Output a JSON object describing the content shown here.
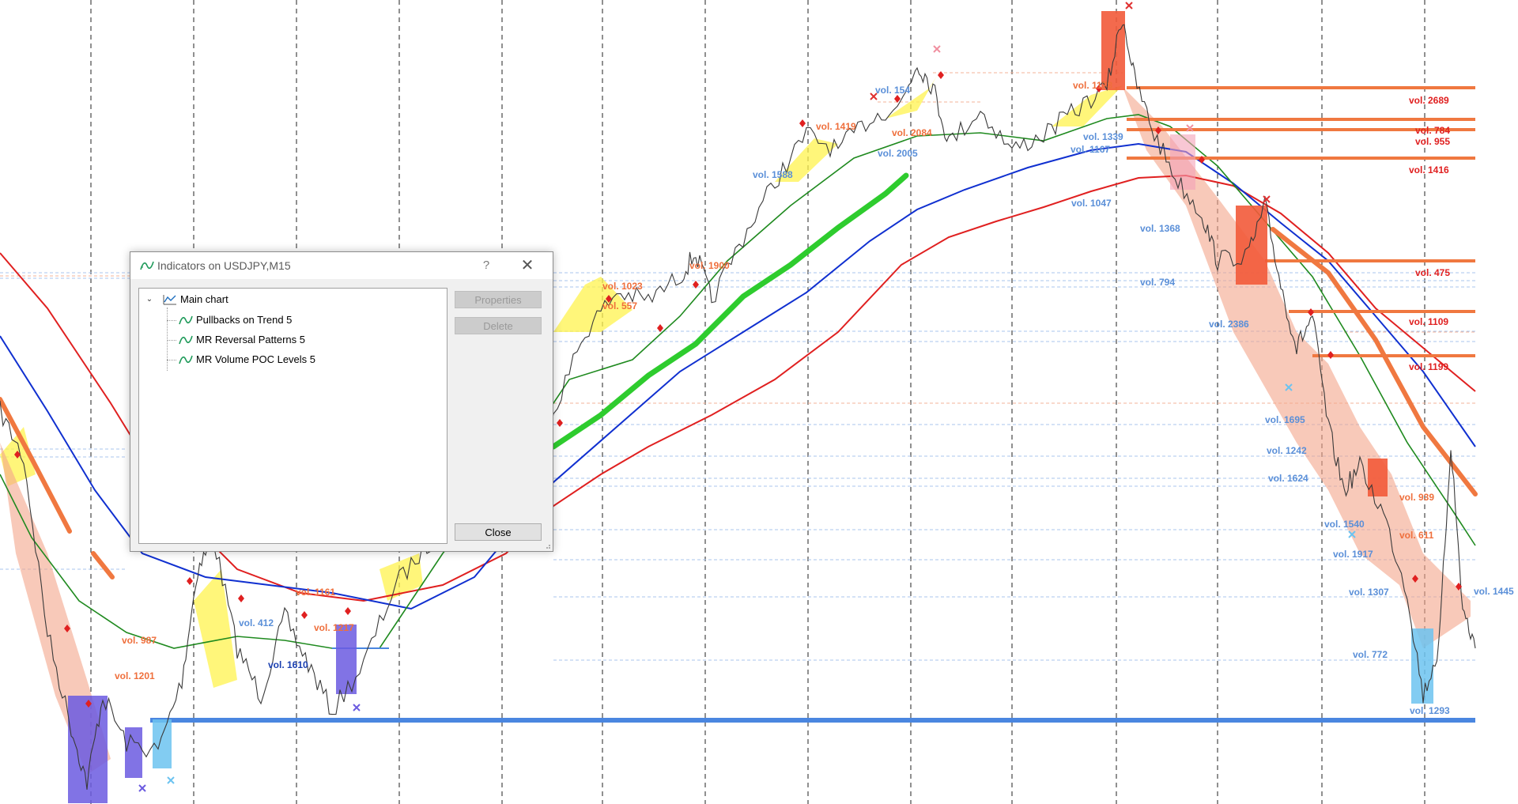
{
  "chart": {
    "vol_labels": [
      {
        "text": "vol. 2689",
        "color": "#e02020"
      },
      {
        "text": "vol. 784",
        "color": "#e02020"
      },
      {
        "text": "vol. 955",
        "color": "#e02020"
      },
      {
        "text": "vol. 1416",
        "color": "#e02020"
      },
      {
        "text": "vol. 475",
        "color": "#e02020"
      },
      {
        "text": "vol. 1109",
        "color": "#e02020"
      },
      {
        "text": "vol. 1199",
        "color": "#e02020"
      },
      {
        "text": "vol. 939",
        "color": "#ef6f3c"
      },
      {
        "text": "vol. 611",
        "color": "#ef6f3c"
      },
      {
        "text": "vol. 1023",
        "color": "#ef6f3c"
      },
      {
        "text": "vol. 1900",
        "color": "#ef6f3c"
      },
      {
        "text": "vol. 1161",
        "color": "#ef6f3c"
      },
      {
        "text": "vol. 987",
        "color": "#ef6f3c"
      },
      {
        "text": "vol. 1201",
        "color": "#ef6f3c"
      },
      {
        "text": "vol. 1217",
        "color": "#ef6f3c"
      },
      {
        "text": "vol. 1419",
        "color": "#ef6f3c"
      },
      {
        "text": "vol. 2084",
        "color": "#ef6f3c"
      },
      {
        "text": "vol. 1178",
        "color": "#ef6f3c"
      },
      {
        "text": "vol. 557",
        "color": "#ef6f3c"
      },
      {
        "text": "vol. 1588",
        "color": "#5a8fd8"
      },
      {
        "text": "vol. 154",
        "color": "#5a8fd8"
      },
      {
        "text": "vol. 2005",
        "color": "#5a8fd8"
      },
      {
        "text": "vol. 1339",
        "color": "#5a8fd8"
      },
      {
        "text": "vol. 1167",
        "color": "#5a8fd8"
      },
      {
        "text": "vol. 1047",
        "color": "#5a8fd8"
      },
      {
        "text": "vol. 1368",
        "color": "#5a8fd8"
      },
      {
        "text": "vol. 794",
        "color": "#5a8fd8"
      },
      {
        "text": "vol. 2386",
        "color": "#5a8fd8"
      },
      {
        "text": "vol. 1695",
        "color": "#5a8fd8"
      },
      {
        "text": "vol. 1242",
        "color": "#5a8fd8"
      },
      {
        "text": "vol. 1624",
        "color": "#5a8fd8"
      },
      {
        "text": "vol. 1540",
        "color": "#5a8fd8"
      },
      {
        "text": "vol. 1917",
        "color": "#5a8fd8"
      },
      {
        "text": "vol. 1307",
        "color": "#5a8fd8"
      },
      {
        "text": "vol. 772",
        "color": "#5a8fd8"
      },
      {
        "text": "vol. 1445",
        "color": "#5a8fd8"
      },
      {
        "text": "vol. 1293",
        "color": "#5a8fd8"
      },
      {
        "text": "vol. 1610",
        "color": "#1a3fb0"
      },
      {
        "text": "vol. 412",
        "color": "#5a8fd8"
      },
      {
        "text": "vol. 1175",
        "color": "#5a8fd8"
      }
    ],
    "colors": {
      "poc_resistance": "#f07840",
      "poc_support": "#4a86e0",
      "ma_fast": "#2ecc2e",
      "ma_green": "#1f8a1f",
      "ma_blue": "#1030d0",
      "ma_red": "#e02020",
      "ribbon_yellow": "#fff34d",
      "ribbon_salmon": "#f4a58a",
      "bear_block": "#f25a3a",
      "bull_block": "#6b5be0",
      "support_block": "#6cc3f0",
      "grid": "#222222"
    }
  },
  "dialog": {
    "title": "Indicators on USDJPY,M15",
    "help": "?",
    "tree": {
      "root": "Main chart",
      "items": [
        "Pullbacks on Trend 5",
        "MR Reversal Patterns 5",
        "MR Volume POC Levels 5"
      ]
    },
    "buttons": {
      "properties": "Properties",
      "delete": "Delete",
      "close": "Close"
    }
  }
}
